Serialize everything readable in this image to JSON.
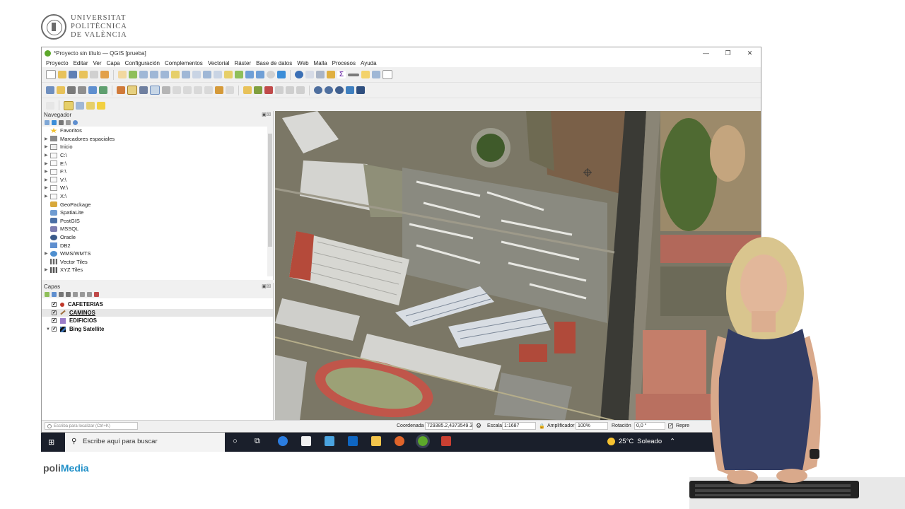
{
  "university": {
    "line1": "UNIVERSITAT",
    "line2": "POLITÈCNICA",
    "line3": "DE VALÈNCIA"
  },
  "brand": {
    "prefix": "poli",
    "suffix": "Media"
  },
  "window": {
    "title": "*Proyecto sin título — QGIS [prueba]"
  },
  "menu": [
    "Proyecto",
    "Editar",
    "Ver",
    "Capa",
    "Configuración",
    "Complementos",
    "Vectorial",
    "Ráster",
    "Base de datos",
    "Web",
    "Malla",
    "Procesos",
    "Ayuda"
  ],
  "navigator": {
    "title": "Navegador",
    "items": [
      {
        "label": "Favoritos",
        "icon": "star-icon",
        "expandable": false
      },
      {
        "label": "Marcadores espaciales",
        "icon": "bookmark-icon",
        "expandable": true
      },
      {
        "label": "Inicio",
        "icon": "home-folder-icon",
        "expandable": true
      },
      {
        "label": "C:\\",
        "icon": "folder-icon",
        "expandable": true
      },
      {
        "label": "E:\\",
        "icon": "folder-icon",
        "expandable": true
      },
      {
        "label": "F:\\",
        "icon": "folder-icon",
        "expandable": true
      },
      {
        "label": "V:\\",
        "icon": "folder-icon",
        "expandable": true
      },
      {
        "label": "W:\\",
        "icon": "folder-icon",
        "expandable": true
      },
      {
        "label": "X:\\",
        "icon": "folder-icon",
        "expandable": true
      },
      {
        "label": "GeoPackage",
        "icon": "geopackage-icon",
        "expandable": false
      },
      {
        "label": "SpatiaLite",
        "icon": "spatialite-icon",
        "expandable": false
      },
      {
        "label": "PostGIS",
        "icon": "postgis-icon",
        "expandable": false
      },
      {
        "label": "MSSQL",
        "icon": "mssql-icon",
        "expandable": false
      },
      {
        "label": "Oracle",
        "icon": "oracle-icon",
        "expandable": false
      },
      {
        "label": "DB2",
        "icon": "db2-icon",
        "expandable": false
      },
      {
        "label": "WMS/WMTS",
        "icon": "wms-icon",
        "expandable": true
      },
      {
        "label": "Vector Tiles",
        "icon": "vector-tiles-icon",
        "expandable": false
      },
      {
        "label": "XYZ Tiles",
        "icon": "xyz-tiles-icon",
        "expandable": true
      }
    ]
  },
  "layers": {
    "title": "Capas",
    "items": [
      {
        "label": "CAFETERIAS",
        "symbol": "point-symbol-icon",
        "color": "#c0392b",
        "checked": true,
        "selected": false
      },
      {
        "label": "CAMINOS",
        "symbol": "line-symbol-icon",
        "color": "#a07040",
        "checked": true,
        "selected": true
      },
      {
        "label": "EDIFICIOS",
        "symbol": "polygon-symbol-icon",
        "color": "#9a7cc9",
        "checked": true,
        "selected": false
      },
      {
        "label": "Bing Satellite",
        "symbol": "raster-symbol-icon",
        "color": "#3a6fb0",
        "checked": true,
        "selected": false
      }
    ]
  },
  "status": {
    "search_placeholder": "Escriba para localizar (Ctrl+K)",
    "coord_label": "Coordenada",
    "coord_value": "729385.2,4373549.3",
    "scale_label": "Escala",
    "scale_value": "1:1687",
    "magnifier_label": "Amplificador",
    "magnifier_value": "100%",
    "rotation_label": "Rotación",
    "rotation_value": "0,0 °",
    "render_label": "Repre"
  },
  "taskbar": {
    "search_placeholder": "Escribe aquí para buscar",
    "weather_temp": "25°C",
    "weather_desc": "Soleado"
  }
}
